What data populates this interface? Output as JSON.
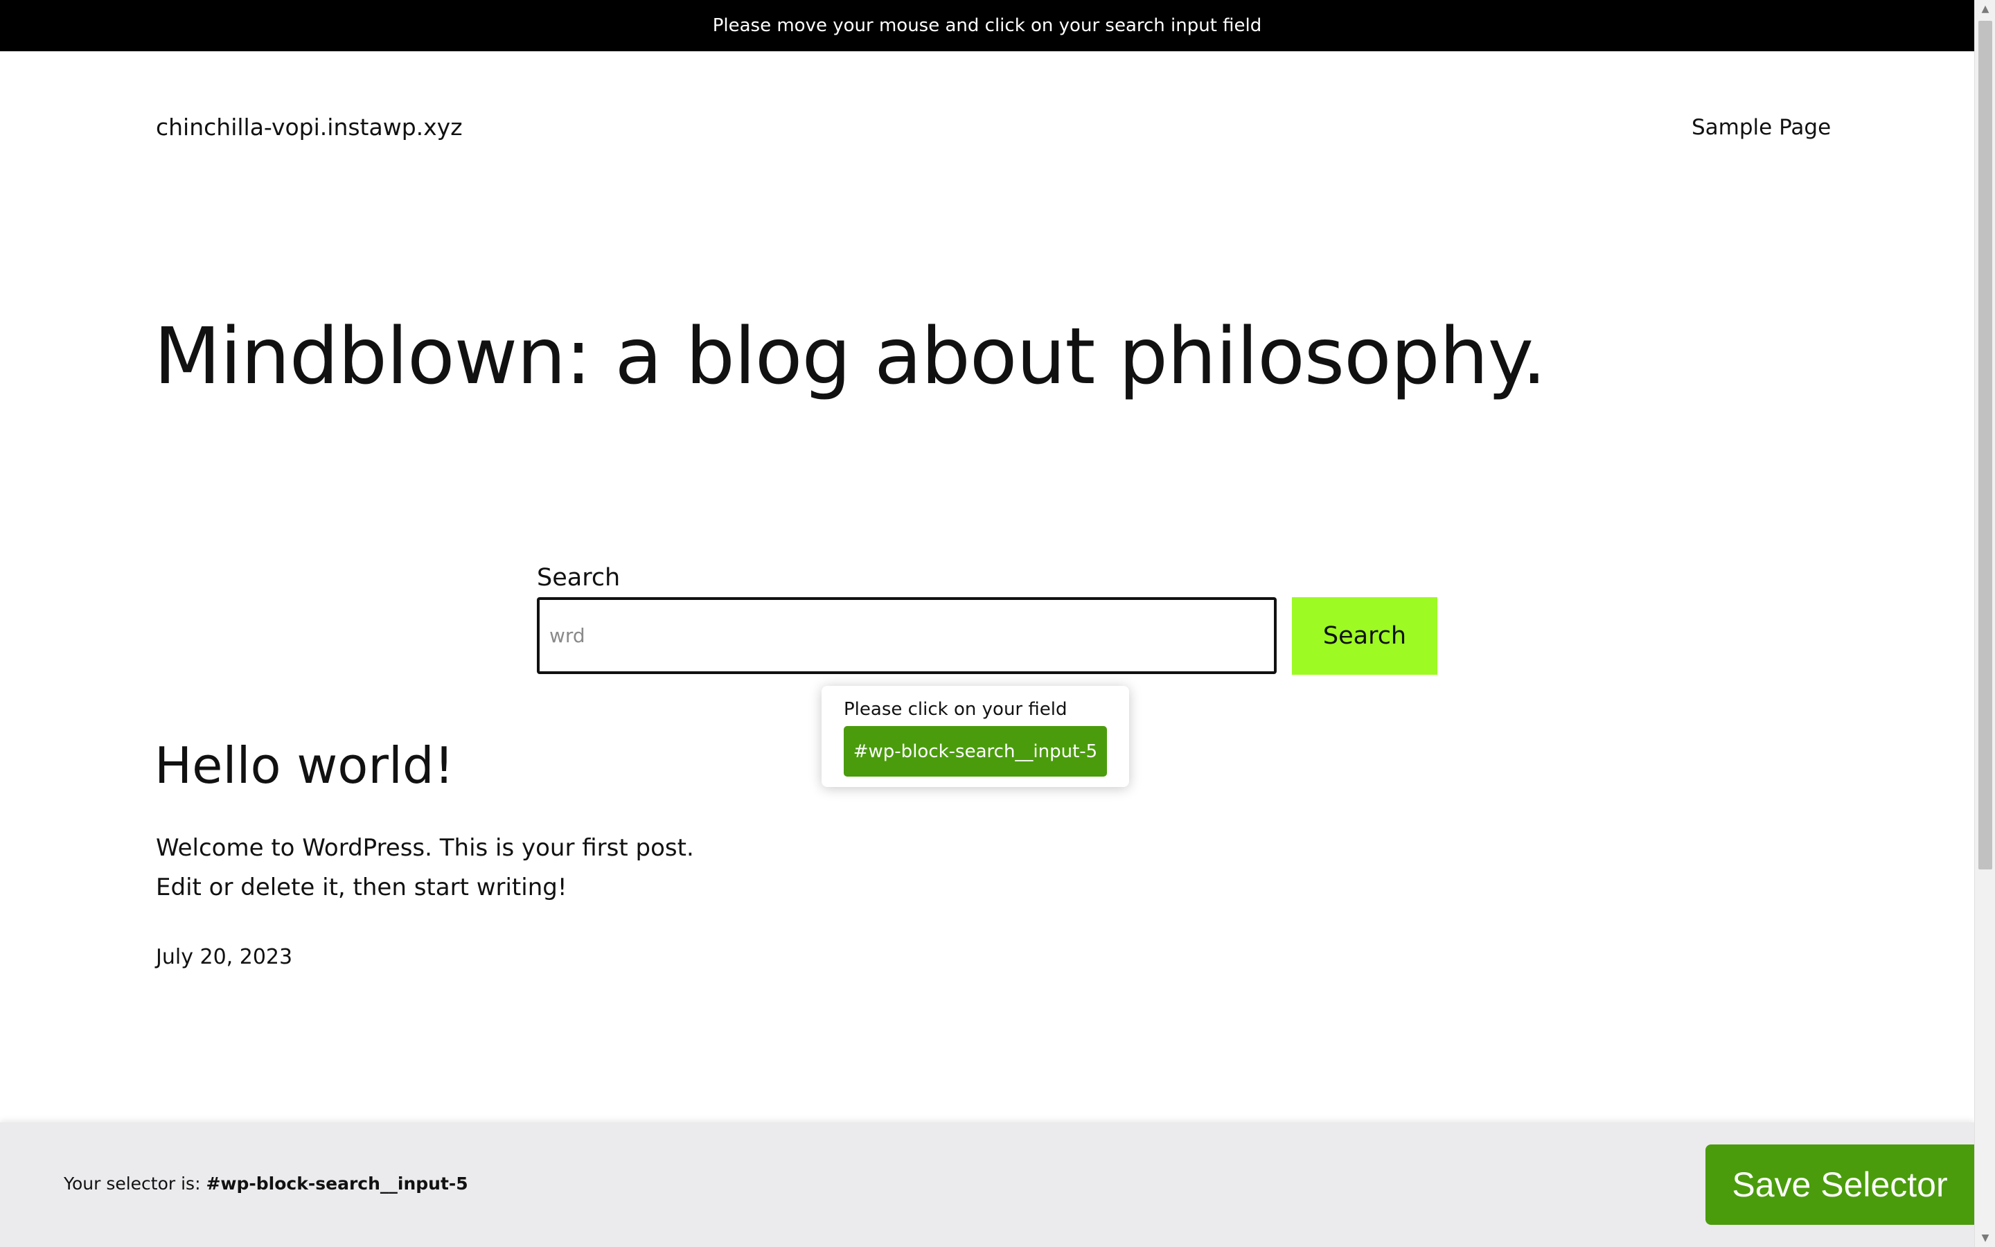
{
  "top_bar": {
    "message": "Please move your mouse and click on your search input field"
  },
  "header": {
    "site_title": "chinchilla-vopi.instawp.xyz",
    "nav_items": [
      {
        "label": "Sample Page"
      }
    ]
  },
  "hero": {
    "title": "Mindblown: a blog about philosophy."
  },
  "search": {
    "label": "Search",
    "placeholder": "wrd",
    "value": "",
    "button_label": "Search"
  },
  "tooltip": {
    "text": "Please click on your field",
    "selector": "#wp-block-search__input-5"
  },
  "post": {
    "title": "Hello world!",
    "excerpt_line1": "Welcome to WordPress. This is your first post.",
    "excerpt_line2": "Edit or delete it, then start writing!",
    "date": "July 20, 2023"
  },
  "bottom_panel": {
    "selector_prefix": "Your selector is: ",
    "selector_value": "#wp-block-search__input-5",
    "save_label": "Save Selector"
  },
  "scrollbar": {
    "up_icon": "scroll-up-arrow-icon",
    "down_icon": "scroll-down-arrow-icon"
  },
  "colors": {
    "accent_green": "#4a9c0c",
    "search_button": "#9dfa23",
    "top_bar": "#000000",
    "bottom_panel": "#ebebed"
  }
}
